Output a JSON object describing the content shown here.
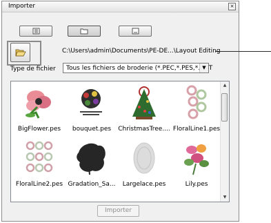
{
  "dialog": {
    "title": "Importer",
    "close_glyph": "×"
  },
  "toolbar": {
    "view_buttons": [
      {
        "icon": "list-view-icon"
      },
      {
        "icon": "folder-view-icon"
      },
      {
        "icon": "preview-view-icon"
      }
    ],
    "open_folder_icon": "open-folder-icon",
    "path": "C:\\Users\\admin\\Documents\\PE-DE...\\Layout  Editing"
  },
  "filter": {
    "label": "Type de fichier",
    "value": "Tous les fichiers de broderie (*.PEC,*.PES,*.DST"
  },
  "files": [
    {
      "name": "BigFlower.pes"
    },
    {
      "name": "bouquet.pes"
    },
    {
      "name": "ChristmasTree...."
    },
    {
      "name": "FloralLine1.pes"
    },
    {
      "name": "FloralLine2.pes"
    },
    {
      "name": "Gradation_Sa..."
    },
    {
      "name": "Largelace.pes"
    },
    {
      "name": "Lily.pes"
    }
  ],
  "actions": {
    "import_label": "Importer"
  }
}
